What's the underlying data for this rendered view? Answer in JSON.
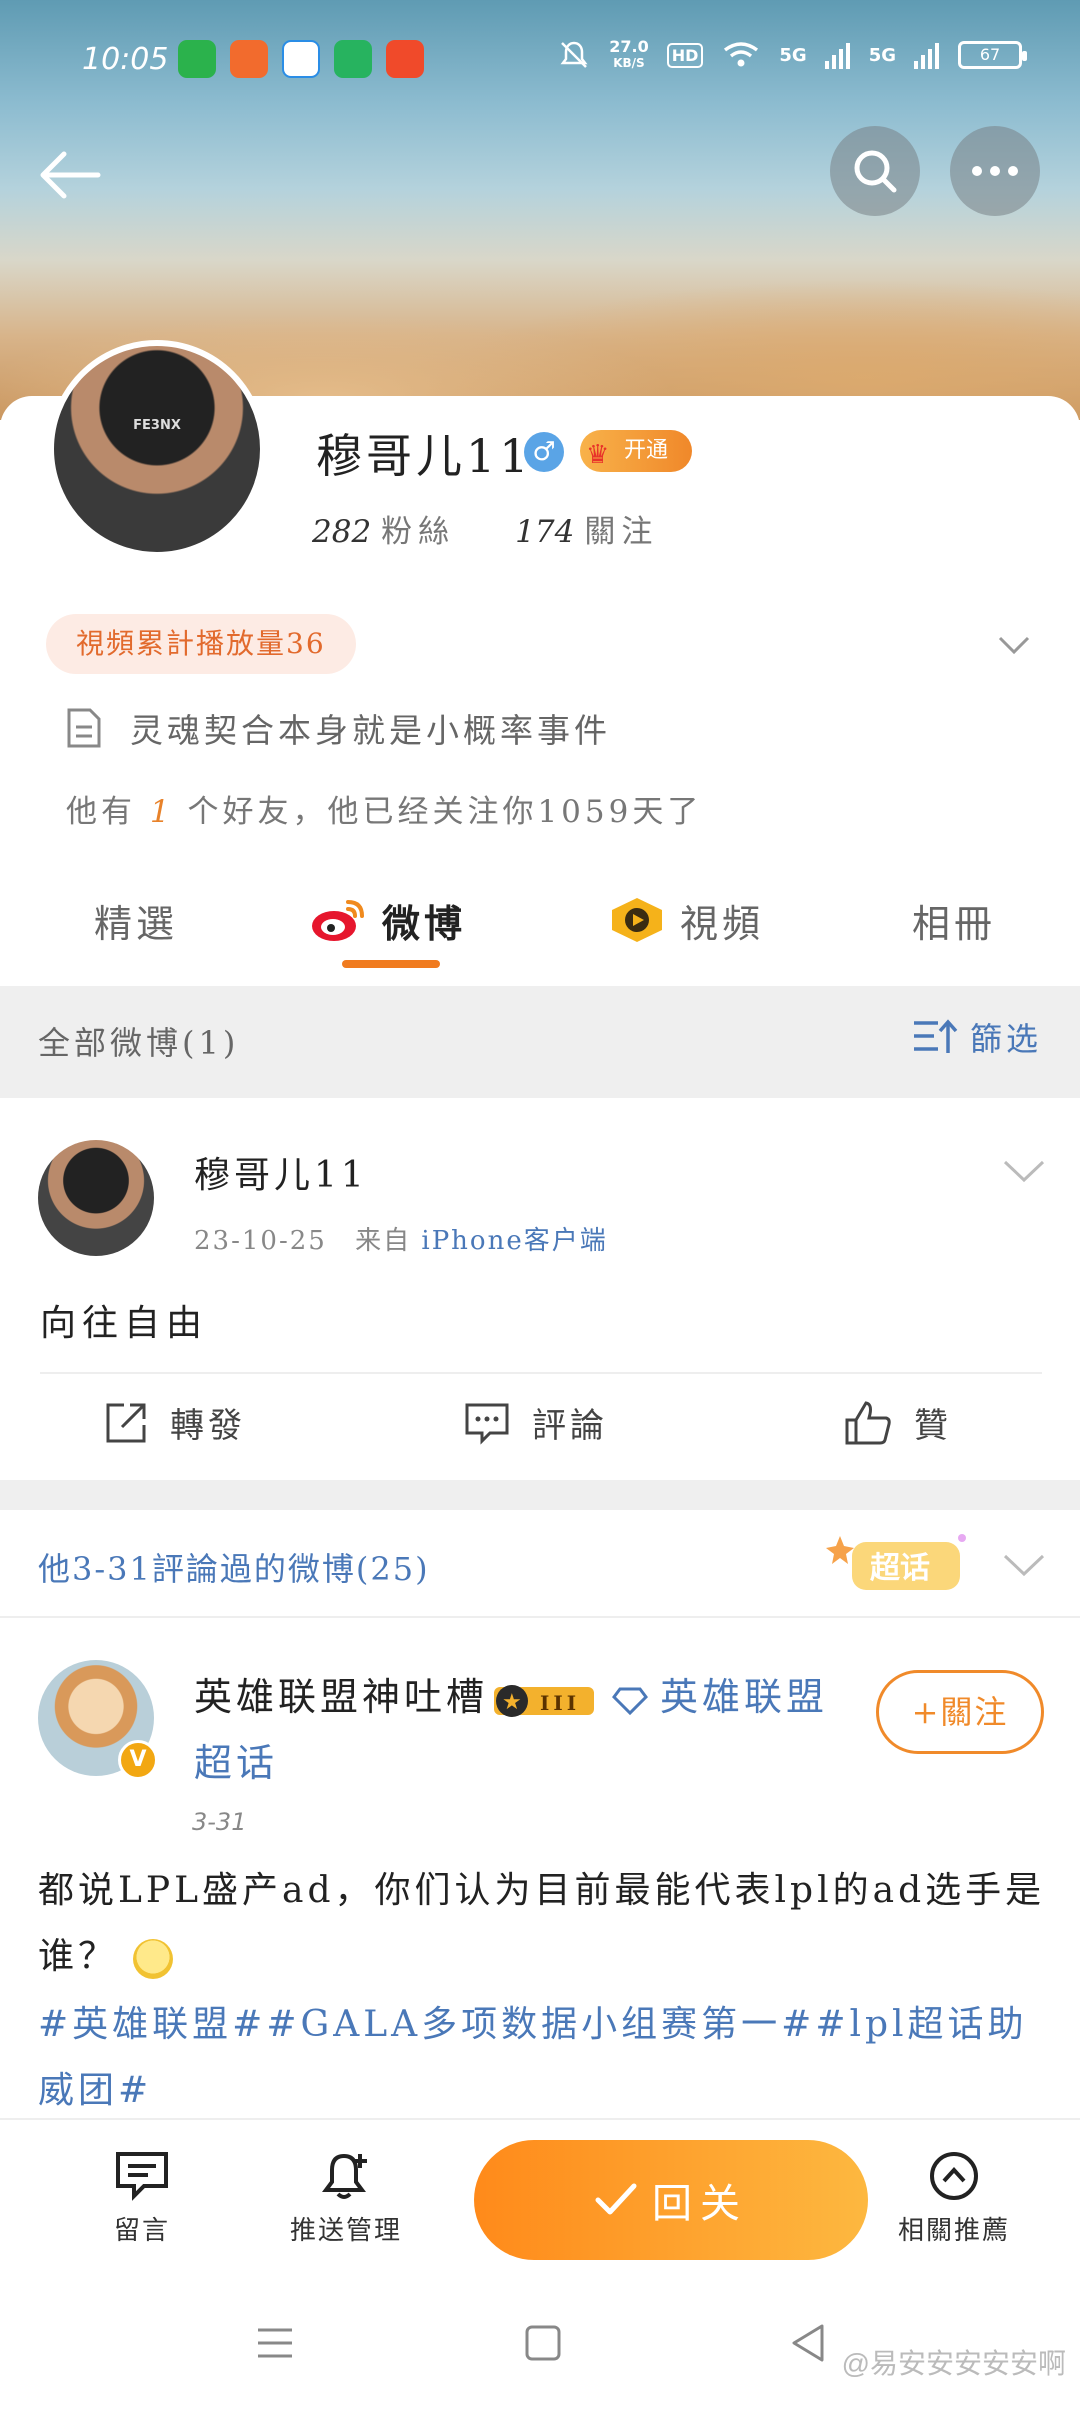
{
  "status_bar": {
    "time": "10:05",
    "net_speed_value": "27.0",
    "net_speed_unit": "KB/S",
    "hd_label": "HD",
    "signal_1": "5G",
    "signal_2": "5G",
    "battery": "67"
  },
  "profile": {
    "username": "穆哥儿11",
    "gender_symbol": "♂",
    "vip_label": "开通",
    "followers_count": "282",
    "followers_label": "粉絲",
    "following_count": "174",
    "following_label": "關注",
    "play_count_badge": "視頻累計播放量36",
    "bio": "灵魂契合本身就是小概率事件",
    "friends_prefix": "他有",
    "friends_count": "1",
    "friends_suffix": "个好友，他已经关注你1059天了"
  },
  "tabs": [
    {
      "label": "精選"
    },
    {
      "label": "微博"
    },
    {
      "label": "視頻"
    },
    {
      "label": "相冊"
    }
  ],
  "filter": {
    "label": "全部微博(1)",
    "button": "篩选"
  },
  "post1": {
    "author": "穆哥儿11",
    "date": "23-10-25",
    "source_prefix": "来自",
    "source": "iPhone客户端",
    "content": "向往自由",
    "repost_label": "轉發",
    "comment_label": "評論",
    "like_label": "贊"
  },
  "commented_section": {
    "title": "他3-31評論過的微博(25)",
    "sticker_label": "超话"
  },
  "post2": {
    "author": "英雄联盟神吐槽",
    "level": "III",
    "topic": "英雄联盟超话",
    "follow_label": "+關注",
    "verify_mark": "V",
    "time": "3-31",
    "content": "都说LPL盛产ad，你们认为目前最能代表lpl的ad选手是谁？",
    "hashtags": "#英雄联盟##GALA多项数据小组赛第一##lpl超话助威团#"
  },
  "bottom_bar": {
    "message_label": "留言",
    "push_label": "推送管理",
    "follow_back_label": "回关",
    "related_label": "相關推薦"
  },
  "watermark": "@易安安安安安啊",
  "colors": {
    "accent_orange": "#f07b1f",
    "link_blue": "#4a78b8",
    "gray_bg": "#efefef"
  }
}
